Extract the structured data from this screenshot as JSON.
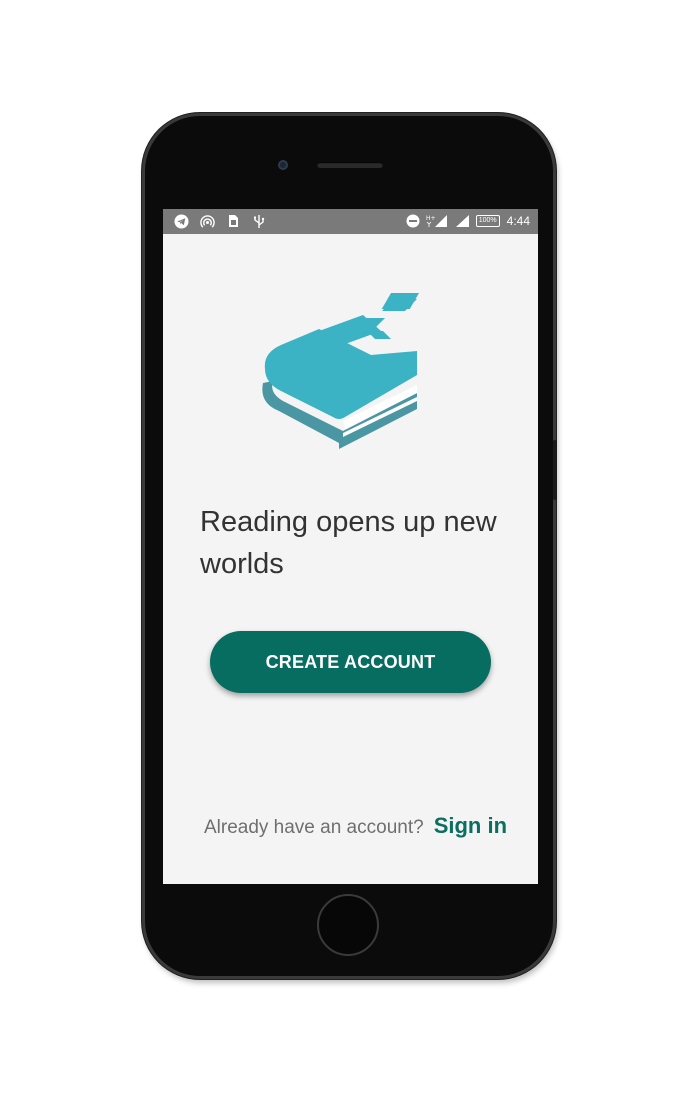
{
  "status_bar": {
    "left_icons": [
      "telegram-icon",
      "hotspot-icon",
      "sim-card-icon",
      "usb-icon"
    ],
    "right_icons": [
      "do-not-disturb-icon",
      "signal-h-plus-icon",
      "signal-icon"
    ],
    "battery": "100%",
    "time": "4:44"
  },
  "main": {
    "logo_icon": "books-icon",
    "tagline": "Reading opens up new worlds",
    "create_account_label": "CREATE ACCOUNT",
    "signin_prompt": "Already have an account?",
    "signin_link": "Sign in"
  },
  "colors": {
    "primary": "#076d60",
    "logo": "#3bb3c4",
    "screen_background": "#f4f4f4",
    "status_bar": "#7a7a7a"
  }
}
